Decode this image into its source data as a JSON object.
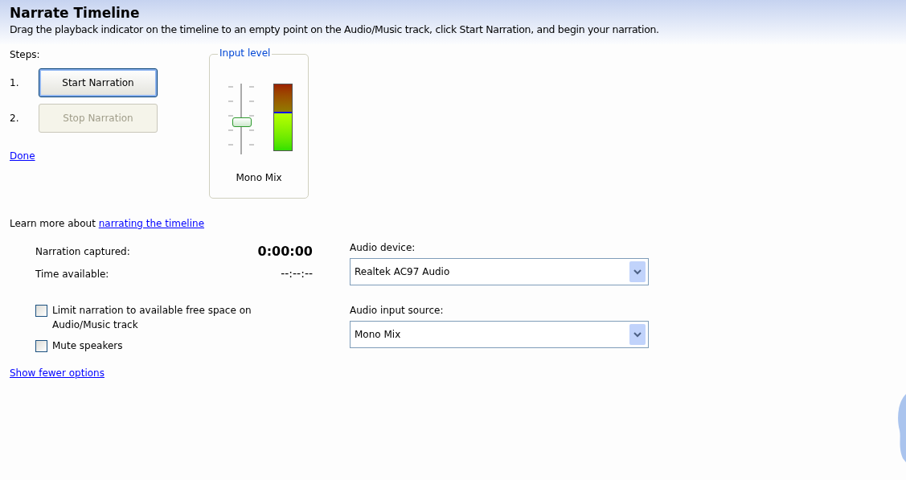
{
  "title": "Narrate Timeline",
  "instructions": "Drag the playback indicator on the timeline to an empty point on the Audio/Music track, click Start Narration, and begin your narration.",
  "steps_label": "Steps:",
  "steps": [
    {
      "number": "1.",
      "label": "Start Narration",
      "disabled": false,
      "focused": true
    },
    {
      "number": "2.",
      "label": "Stop Narration",
      "disabled": true,
      "focused": false
    }
  ],
  "done_link": "Done",
  "input_level": {
    "title": "Input level",
    "slider": {
      "level": 0.44
    },
    "meter": {
      "level": 0.58
    },
    "source": "Mono Mix"
  },
  "learn_more": {
    "text": "Learn more about",
    "link": "narrating the timeline"
  },
  "stats": [
    {
      "label": "Narration captured:",
      "value": "0:00:00",
      "bold": true
    },
    {
      "label": "Time available:",
      "value": "--:--:--",
      "bold": false
    }
  ],
  "options": [
    {
      "label": "Limit narration to available free space on Audio/Music track",
      "checked": false
    },
    {
      "label": "Mute speakers",
      "checked": false
    }
  ],
  "dropdowns": [
    {
      "label": "Audio device:",
      "value": "Realtek AC97 Audio"
    },
    {
      "label": "Audio input source:",
      "value": "Mono Mix"
    }
  ],
  "show_fewer_link": "Show fewer options"
}
